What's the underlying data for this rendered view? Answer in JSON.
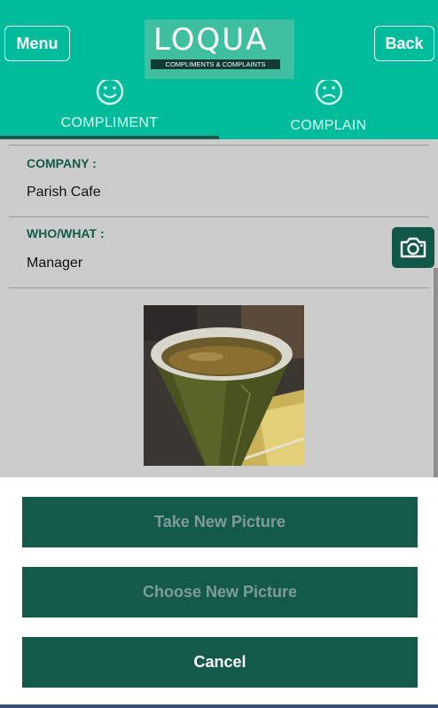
{
  "header": {
    "menu_label": "Menu",
    "back_label": "Back",
    "logo_title": "LOQUA",
    "logo_subtitle": "COMPLIMENTS & COMPLAINTS",
    "color": "#00bc9a"
  },
  "tabs": [
    {
      "label": "COMPLIMENT",
      "icon": "smiley-icon",
      "active": true
    },
    {
      "label": "COMPLAIN",
      "icon": "frown-icon",
      "active": false
    }
  ],
  "form": {
    "company_label": "COMPANY :",
    "company_value": "Parish Cafe",
    "who_label": "WHO/WHAT :",
    "who_value": "Manager",
    "camera_icon": "camera-icon",
    "photo_description": "cup-photo"
  },
  "action_sheet": {
    "take_label": "Take New Picture",
    "choose_label": "Choose New Picture",
    "cancel_label": "Cancel",
    "button_color": "#145a4b"
  }
}
